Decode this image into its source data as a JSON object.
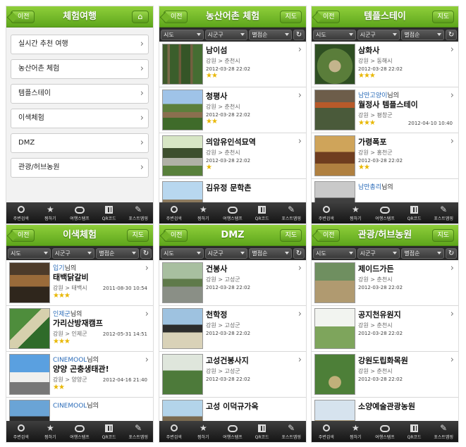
{
  "tab_labels": [
    "주변검색",
    "찜하기",
    "여행스탬프",
    "QR코드",
    "포스트맵핑"
  ],
  "filters": [
    "시도",
    "시군구",
    "별점순"
  ],
  "back": "이전",
  "map": "지도",
  "screen1": {
    "title": "체험여행",
    "items": [
      "실시간 추천 여행",
      "농산어촌 체험",
      "템플스테이",
      "이색체험",
      "DMZ",
      "관광/허브농원"
    ]
  },
  "screen2": {
    "title": "농산어촌 체험",
    "rows": [
      {
        "name": "남이섬",
        "region": "강원 > 춘천시",
        "date": "2012-03-28 22:02",
        "stars": "★★"
      },
      {
        "name": "청평사",
        "region": "강원 > 춘천시",
        "date": "2012-03-28 22:02",
        "stars": "★★"
      },
      {
        "name": "의암유인석묘역",
        "region": "강원 > 춘천시",
        "date": "2012-03-28 22:02",
        "stars": "★"
      },
      {
        "name": "김유정 문학촌",
        "region": "",
        "date": "",
        "stars": ""
      }
    ]
  },
  "screen3": {
    "title": "템플스테이",
    "rows": [
      {
        "author": "",
        "name": "삼화사",
        "region": "강원 > 동해시",
        "date": "2012-03-28 22:02",
        "stars": "★★★"
      },
      {
        "author_name": "남만고양이",
        "author_suffix": "님의",
        "name": "월정사 템플스테이",
        "region": "강원 > 평창군",
        "date": "2012-04-10 10:40",
        "stars": "★★★"
      },
      {
        "author": "",
        "name": "가령폭포",
        "region": "강원 > 홍천군",
        "date": "2012-03-28 22:02",
        "stars": "★★"
      },
      {
        "author_name": "남만총리",
        "author_suffix": "님의",
        "name": "",
        "region": "",
        "date": "",
        "stars": ""
      }
    ]
  },
  "screen4": {
    "title": "이색체험",
    "rows": [
      {
        "author_name": "입기",
        "author_suffix": "님의",
        "name": "태백닭갈비",
        "region": "강원 > 태백시",
        "date": "2011-08-30 10:54",
        "stars": "★★★"
      },
      {
        "author_name": "인제군",
        "author_suffix": "님의",
        "name": "가리산방재캠프",
        "region": "강원 > 인제군",
        "date": "2012-05-31 14:51",
        "stars": "★★★"
      },
      {
        "author_name": "CINEMOOL",
        "author_suffix": "님의",
        "name": "양양 곤충생태관!",
        "region": "강원 > 양양군",
        "date": "2012-04-16 21:40",
        "stars": "★★"
      },
      {
        "author_name": "CINEMOOL",
        "author_suffix": "님의",
        "name": "",
        "region": "",
        "date": "",
        "stars": ""
      }
    ]
  },
  "screen5": {
    "title": "DMZ",
    "rows": [
      {
        "name": "건봉사",
        "region": "강원 > 고성군",
        "date": "2012-03-28 22:02"
      },
      {
        "name": "천학정",
        "region": "강원 > 고성군",
        "date": "2012-03-28 22:02"
      },
      {
        "name": "고성건봉사지",
        "region": "강원 > 고성군",
        "date": "2012-03-28 22:02"
      },
      {
        "name": "고성 이덕규가옥",
        "region": "",
        "date": ""
      }
    ]
  },
  "screen6": {
    "title": "관광/허브농원",
    "rows": [
      {
        "name": "제이드가든",
        "region": "강원 > 춘천시",
        "date": "2012-03-28 22:02"
      },
      {
        "name": "공지천유원지",
        "region": "강원 > 춘천시",
        "date": "2012-03-28 22:02"
      },
      {
        "name": "강원도립화목원",
        "region": "강원 > 춘천시",
        "date": "2012-03-28 22:02"
      },
      {
        "name": "소양예술관광농원",
        "region": "",
        "date": ""
      }
    ]
  }
}
